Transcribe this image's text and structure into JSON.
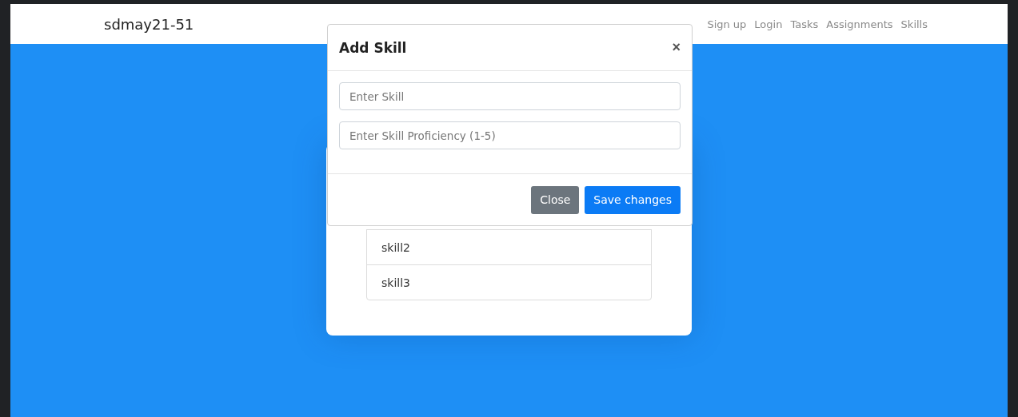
{
  "navbar": {
    "brand": "sdmay21-51",
    "links": [
      "Sign up",
      "Login",
      "Tasks",
      "Assignments",
      "Skills"
    ]
  },
  "skills_list": [
    "skill2",
    "skill3"
  ],
  "modal": {
    "title": "Add Skill",
    "close_symbol": "×",
    "fields": [
      {
        "placeholder": "Enter Skill"
      },
      {
        "placeholder": "Enter Skill Proficiency (1-5)"
      }
    ],
    "buttons": [
      {
        "label": "Close",
        "kind": "secondary"
      },
      {
        "label": "Save changes",
        "kind": "primary"
      }
    ]
  }
}
